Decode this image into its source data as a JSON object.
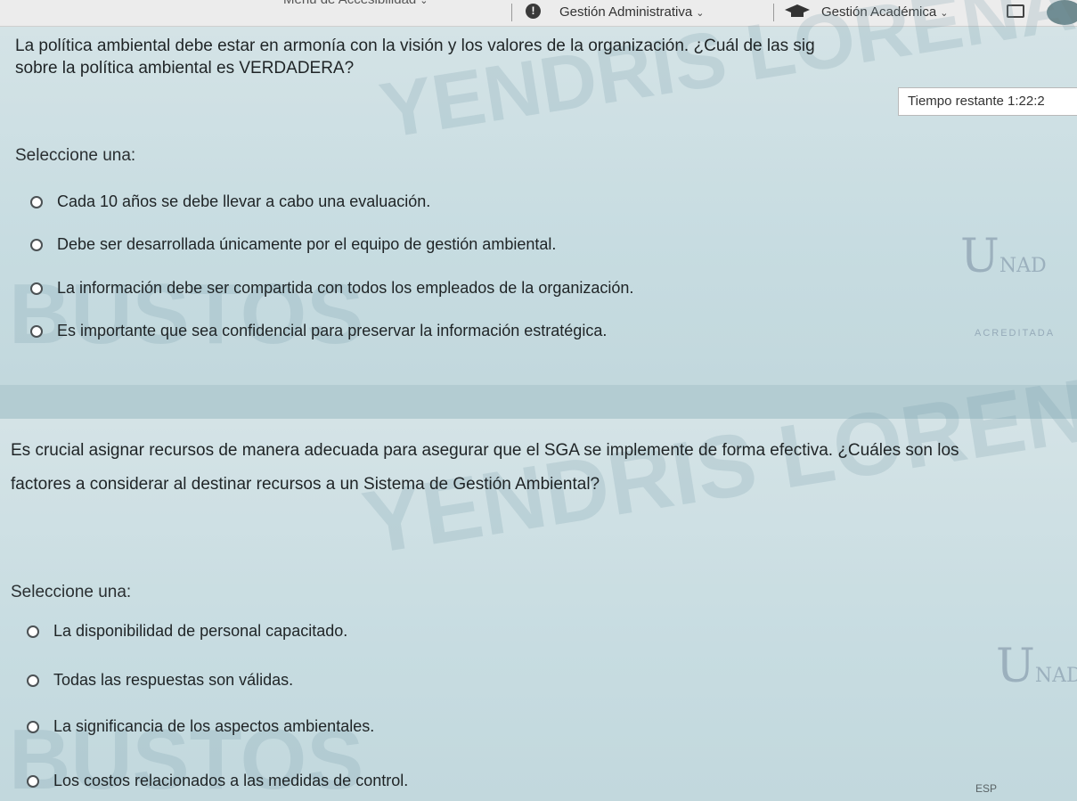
{
  "nav": {
    "accessibility_menu": "Menú de Accesibilidad",
    "admin_management": "Gestión Administrativa",
    "academic_management": "Gestión Académica"
  },
  "watermark": {
    "line1": "YENDRIS LORENA QUINTERO",
    "line2": "BUSTOS"
  },
  "logo": {
    "u": "U",
    "nad": "NAD",
    "tag": "ACREDITADA"
  },
  "timer": {
    "label": "Tiempo restante",
    "value": "1:22:2"
  },
  "question1": {
    "text_line1": "La política ambiental debe estar en armonía con la visión y los valores de la organización. ¿Cuál de las sig",
    "text_line2": "sobre la política ambiental es VERDADERA?",
    "select_label": "Seleccione una:",
    "options": [
      "Cada 10 años se debe llevar a cabo una evaluación.",
      "Debe ser desarrollada únicamente por el equipo de gestión ambiental.",
      "La información debe ser compartida con todos los empleados de la organización.",
      "Es importante que sea confidencial para preservar la información estratégica."
    ]
  },
  "question2": {
    "text_line1": "Es crucial asignar recursos de manera adecuada para asegurar que el SGA se implemente de forma efectiva. ¿Cuáles son los",
    "text_line2": "factores a considerar al destinar recursos a un Sistema de Gestión Ambiental?",
    "select_label": "Seleccione una:",
    "options": [
      "La disponibilidad de personal capacitado.",
      "Todas las respuestas son válidas.",
      "La significancia de los aspectos ambientales.",
      "Los costos relacionados a las medidas de control."
    ]
  },
  "taskbar": {
    "language": "ESP"
  }
}
